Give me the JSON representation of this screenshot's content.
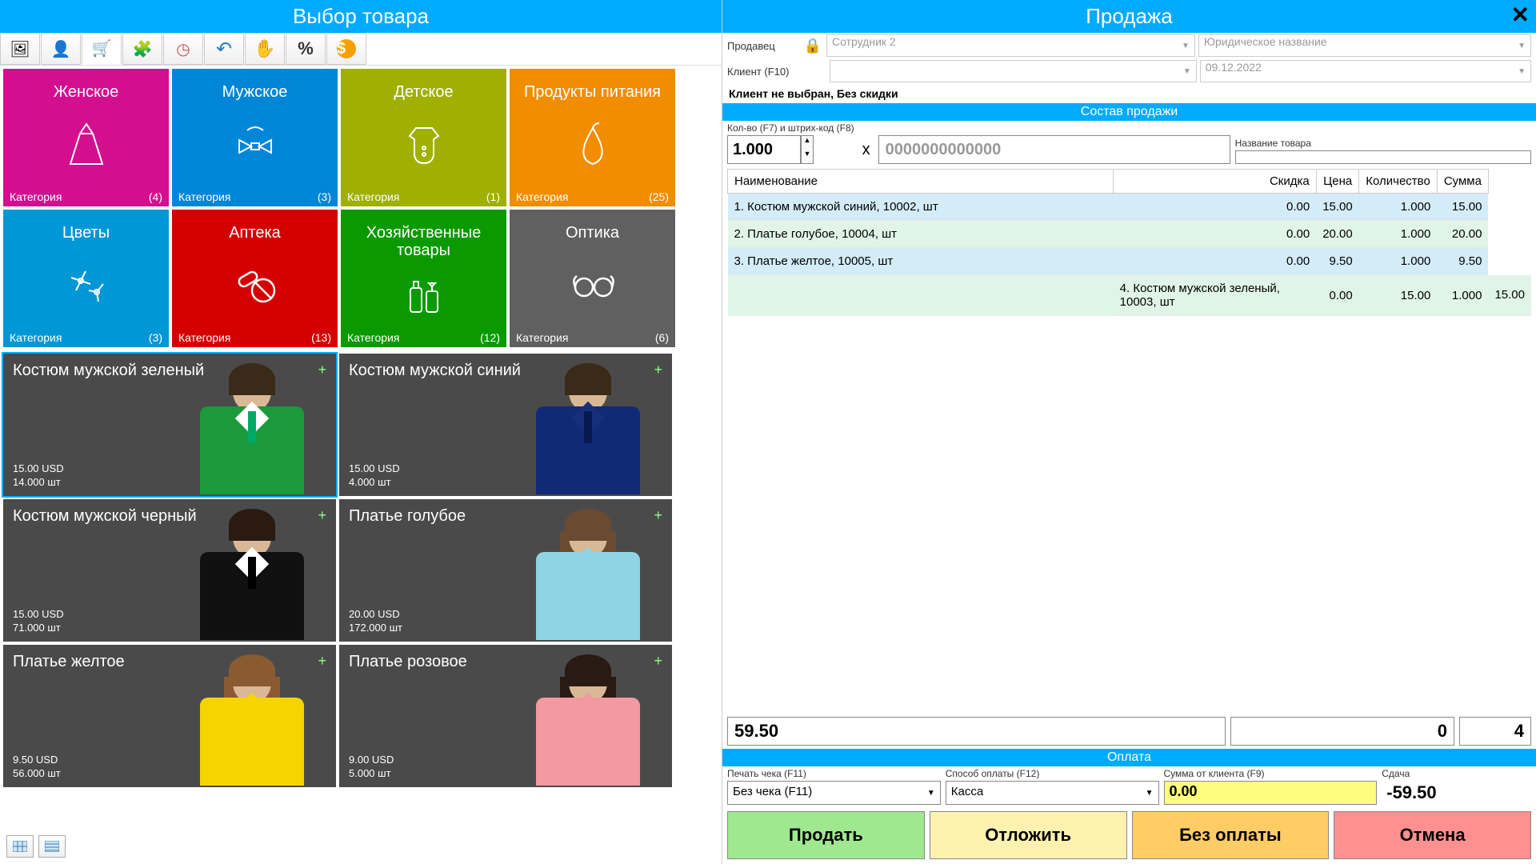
{
  "left": {
    "title": "Выбор товара",
    "toolbar_icons": [
      "picture-icon",
      "person-icon",
      "cart-icon",
      "puzzle-icon",
      "clock-icon",
      "undo-icon",
      "hand-icon",
      "percent-icon",
      "coin-icon"
    ],
    "categories": [
      {
        "name": "Женское",
        "icon": "dress",
        "color": "#d40f8f",
        "footer_label": "Категория",
        "count": "(4)"
      },
      {
        "name": "Мужское",
        "icon": "bowtie",
        "color": "#0086d6",
        "footer_label": "Категория",
        "count": "(3)"
      },
      {
        "name": "Детское",
        "icon": "onesie",
        "color": "#9fb000",
        "footer_label": "Категория",
        "count": "(1)"
      },
      {
        "name": "Продукты питания",
        "icon": "pear",
        "color": "#f28c00",
        "footer_label": "Категория",
        "count": "(25)"
      },
      {
        "name": "Цветы",
        "icon": "flower",
        "color": "#0097d6",
        "footer_label": "Категория",
        "count": "(3)"
      },
      {
        "name": "Аптека",
        "icon": "pills",
        "color": "#d40000",
        "footer_label": "Категория",
        "count": "(13)"
      },
      {
        "name": "Хозяйственные товары",
        "icon": "bottles",
        "color": "#0a9a00",
        "footer_label": "Категория",
        "count": "(12)"
      },
      {
        "name": "Оптика",
        "icon": "glasses",
        "color": "#606060",
        "footer_label": "Категория",
        "count": "(6)"
      }
    ],
    "products": [
      {
        "name": "Костюм мужской зеленый",
        "price": "15.00 USD",
        "stock": "14.000 шт",
        "selected": true,
        "suit": "#1a9a3a",
        "shirt": "#fff",
        "tie": "#0a6",
        "hair": "#3a2a18"
      },
      {
        "name": "Костюм мужской синий",
        "price": "15.00 USD",
        "stock": "4.000 шт",
        "selected": false,
        "suit": "#102a78",
        "shirt": "#14307a",
        "tie": "#081850",
        "hair": "#3a2a18"
      },
      {
        "name": "Костюм мужской черный",
        "price": "15.00 USD",
        "stock": "71.000 шт",
        "selected": false,
        "suit": "#101010",
        "shirt": "#fff",
        "tie": "#000",
        "hair": "#2a1a10"
      },
      {
        "name": "Платье голубое",
        "price": "20.00 USD",
        "stock": "172.000 шт",
        "selected": false,
        "suit": "#8fd4e4",
        "shirt": "#8fd4e4",
        "tie": "#8fd4e4",
        "hair": "#6a4a30",
        "female": true
      },
      {
        "name": "Платье желтое",
        "price": "9.50 USD",
        "stock": "56.000 шт",
        "selected": false,
        "suit": "#f5d400",
        "shirt": "#f5d400",
        "tie": "#f5d400",
        "hair": "#8a5a30",
        "female": true
      },
      {
        "name": "Платье розовое",
        "price": "9.00 USD",
        "stock": "5.000 шт",
        "selected": false,
        "suit": "#f29aa0",
        "shirt": "#f29aa0",
        "tie": "#f29aa0",
        "hair": "#2a1a14",
        "female": true
      }
    ]
  },
  "right": {
    "title": "Продажа",
    "seller_label": "Продавец",
    "seller_value": "Сотрудник 2",
    "legal_value": "Юридическое название",
    "client_label": "Клиент (F10)",
    "date_value": "09.12.2022",
    "discount_line": "Клиент не выбран, Без скидки",
    "composition_bar": "Состав продажи",
    "qty_label": "Кол-во (F7) и штрих-код (F8)",
    "qty_value": "1.000",
    "barcode_value": "0000000000000",
    "name_label": "Название товара",
    "columns": {
      "name": "Наименование",
      "discount": "Скидка",
      "price": "Цена",
      "qty": "Количество",
      "sum": "Сумма"
    },
    "rows": [
      {
        "n": "1.",
        "name": "Костюм мужской синий, 10002, шт",
        "discount": "0.00",
        "price": "15.00",
        "qty": "1.000",
        "sum": "15.00",
        "cls": "row-blue"
      },
      {
        "n": "2.",
        "name": "Платье голубое, 10004, шт",
        "discount": "0.00",
        "price": "20.00",
        "qty": "1.000",
        "sum": "20.00",
        "cls": "row-green"
      },
      {
        "n": "3.",
        "name": "Платье желтое, 10005, шт",
        "discount": "0.00",
        "price": "9.50",
        "qty": "1.000",
        "sum": "9.50",
        "cls": "row-blue"
      },
      {
        "n": "4.",
        "name": "Костюм мужской зеленый, 10003, шт",
        "discount": "0.00",
        "price": "15.00",
        "qty": "1.000",
        "sum": "15.00",
        "cls": "row-green row-active"
      }
    ],
    "total_sum": "59.50",
    "total_mid": "0",
    "total_qty": "4",
    "payment_bar": "Оплата",
    "receipt_label": "Печать чека (F11)",
    "receipt_value": "Без чека (F11)",
    "method_label": "Способ оплаты (F12)",
    "method_value": "Касса",
    "amount_label": "Сумма от клиента (F9)",
    "amount_value": "0.00",
    "change_label": "Сдача",
    "change_value": "-59.50",
    "actions": {
      "sell": "Продать",
      "hold": "Отложить",
      "nopay": "Без оплаты",
      "cancel": "Отмена"
    }
  }
}
